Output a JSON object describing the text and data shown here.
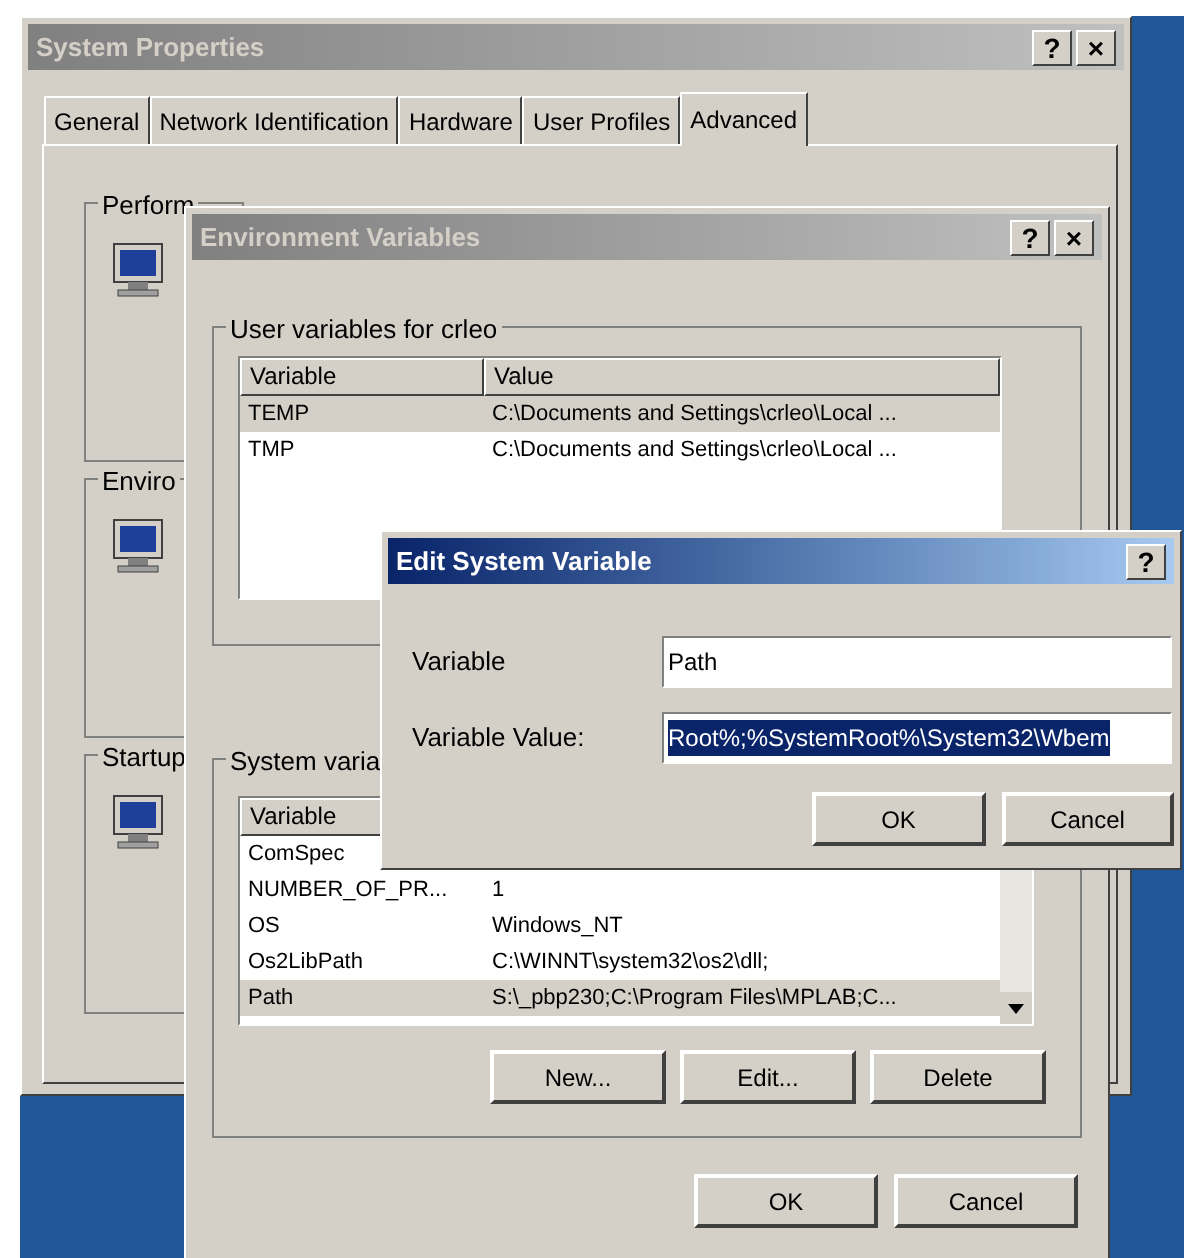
{
  "system_properties": {
    "title": "System Properties",
    "title_buttons": [
      "?",
      "×"
    ],
    "tabs": [
      {
        "label": "General",
        "selected": false
      },
      {
        "label": "Network Identification",
        "selected": false
      },
      {
        "label": "Hardware",
        "selected": false
      },
      {
        "label": "User Profiles",
        "selected": false
      },
      {
        "label": "Advanced",
        "selected": true
      }
    ],
    "groups": [
      {
        "label": "Perform"
      },
      {
        "label": "Enviro"
      },
      {
        "label": "Startup"
      }
    ]
  },
  "environment_variables": {
    "title": "Environment Variables",
    "title_buttons": [
      "?",
      "×"
    ],
    "user_group": {
      "label": "User variables for crleo",
      "columns": [
        "Variable",
        "Value"
      ],
      "rows": [
        {
          "variable": "TEMP",
          "value": "C:\\Documents and Settings\\crleo\\Local ...",
          "selected": true
        },
        {
          "variable": "TMP",
          "value": "C:\\Documents and Settings\\crleo\\Local ...",
          "selected": false
        }
      ]
    },
    "system_group": {
      "label": "System varia",
      "columns": [
        "Variable"
      ],
      "rows": [
        {
          "variable": "ComSpec",
          "selected": false
        },
        {
          "variable": "NUMBER_OF_PR...",
          "value": "1",
          "selected": false
        },
        {
          "variable": "OS",
          "value": "Windows_NT",
          "selected": false
        },
        {
          "variable": "Os2LibPath",
          "value": "C:\\WINNT\\system32\\os2\\dll;",
          "selected": false
        },
        {
          "variable": "Path",
          "value": "S:\\_pbp230;C:\\Program Files\\MPLAB;C...",
          "selected": true
        }
      ]
    },
    "list_buttons": [
      "New...",
      "Edit...",
      "Delete"
    ],
    "buttons": [
      "OK",
      "Cancel"
    ]
  },
  "edit_dialog": {
    "title": "Edit System Variable",
    "title_buttons": [
      "?"
    ],
    "fields": [
      {
        "label": "Variable",
        "value": "Path",
        "selected": false
      },
      {
        "label": "Variable Value:",
        "value": "Root%;%SystemRoot%\\System32\\Wbem",
        "selected": true
      }
    ],
    "buttons": [
      "OK",
      "Cancel"
    ]
  }
}
